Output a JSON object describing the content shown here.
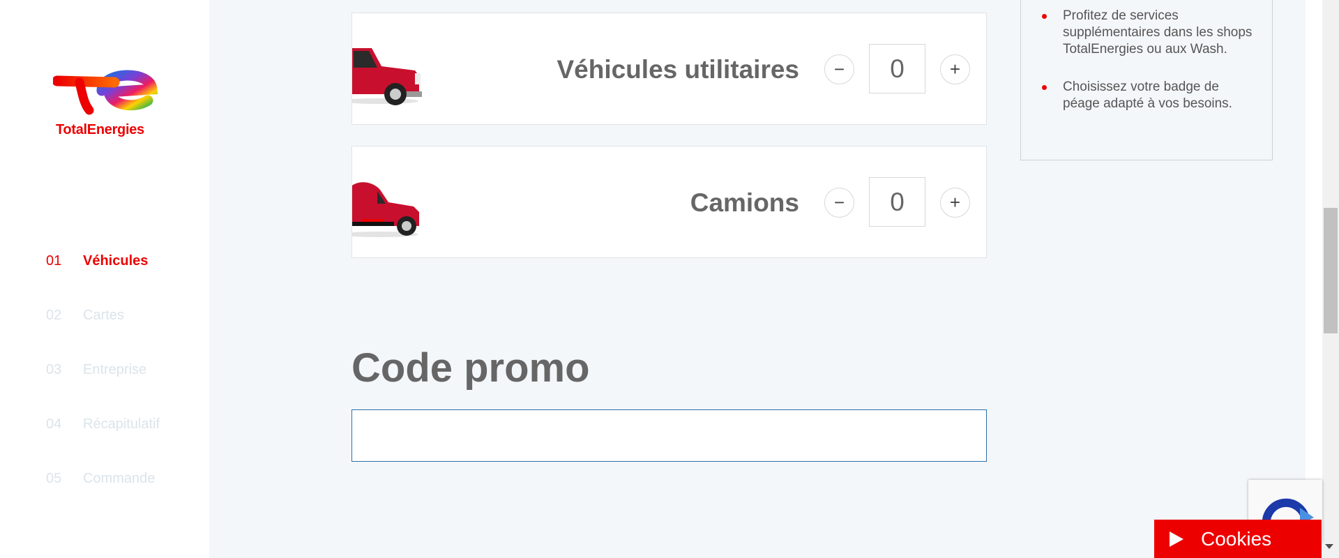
{
  "brand": {
    "name": "TotalEnergies",
    "primary_color": "#ed0000",
    "logo_icon": "totalenergies-logo-icon"
  },
  "sidebar": {
    "steps": [
      {
        "num": "01",
        "label": "Véhicules",
        "active": true
      },
      {
        "num": "02",
        "label": "Cartes",
        "active": false
      },
      {
        "num": "03",
        "label": "Entreprise",
        "active": false
      },
      {
        "num": "04",
        "label": "Récapitulatif",
        "active": false
      },
      {
        "num": "05",
        "label": "Commande",
        "active": false
      }
    ]
  },
  "vehicles": [
    {
      "label": "Véhicules utilitaires",
      "quantity": "0",
      "icon": "van-icon",
      "minus": "−",
      "plus": "+"
    },
    {
      "label": "Camions",
      "quantity": "0",
      "icon": "truck-icon",
      "minus": "−",
      "plus": "+"
    }
  ],
  "promo": {
    "title": "Code promo",
    "value": "",
    "placeholder": ""
  },
  "info": {
    "bullets": [
      "Profitez de services supplémentaires dans les shops TotalEnergies ou aux Wash.",
      "Choisissez votre badge de péage adapté à vos besoins."
    ]
  },
  "cookies": {
    "label": "Cookies",
    "icon": "play-icon"
  },
  "recaptcha": {
    "icon": "recaptcha-icon"
  }
}
